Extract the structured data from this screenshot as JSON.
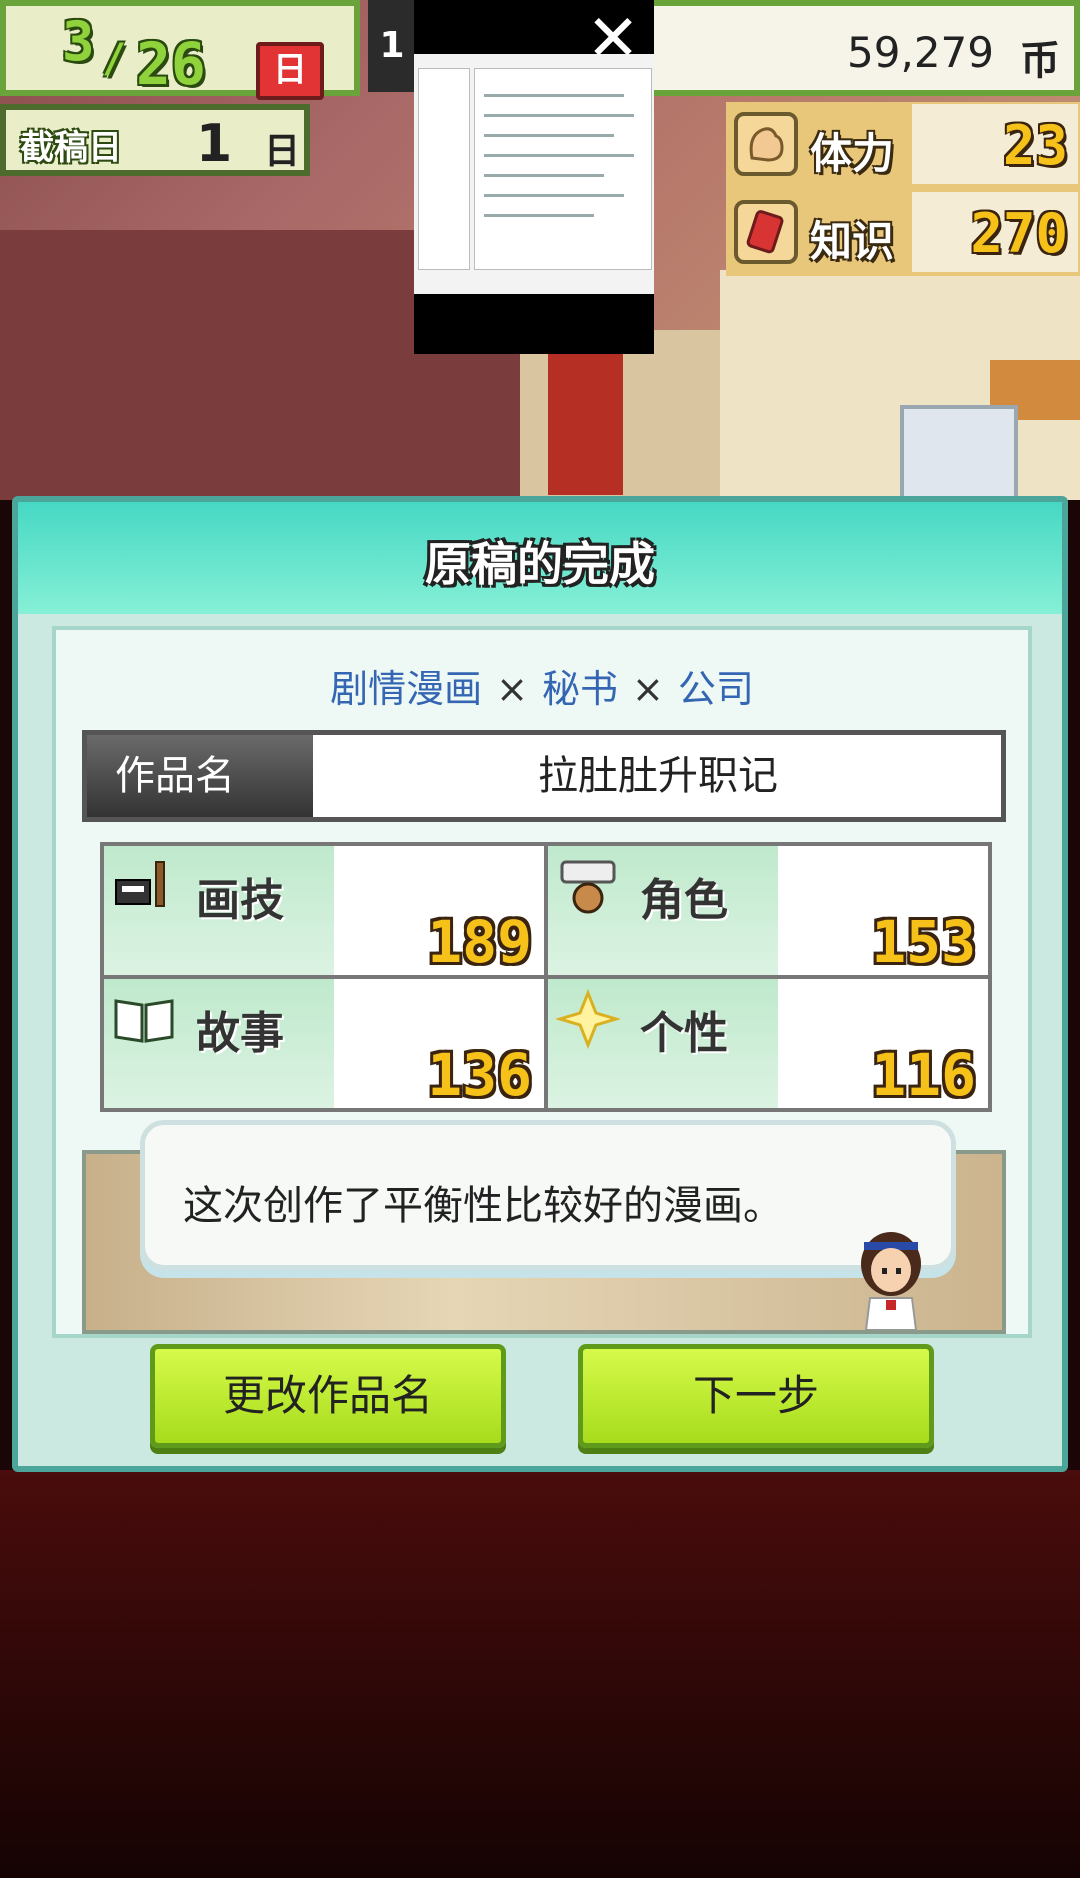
{
  "hud": {
    "date": {
      "month": "3",
      "day": "26",
      "weekday": "日"
    },
    "left_digit": "1",
    "money": {
      "value": "59,279",
      "unit": "币"
    },
    "deadline": {
      "label": "截稿日",
      "value": "1",
      "unit": "日"
    },
    "stats": [
      {
        "label": "体力",
        "value": "23",
        "icon": "muscle-icon"
      },
      {
        "label": "知识",
        "value": "270",
        "icon": "book-icon"
      }
    ]
  },
  "dialog": {
    "title": "原稿的完成",
    "genre": {
      "a": "剧情漫画",
      "b": "秘书",
      "c": "公司",
      "sep": "×"
    },
    "work_name": {
      "label": "作品名",
      "value": "拉肚肚升职记"
    },
    "attributes": [
      {
        "label": "画技",
        "value": "189",
        "icon": "pen-tablet-icon"
      },
      {
        "label": "角色",
        "value": "153",
        "icon": "character-icon"
      },
      {
        "label": "故事",
        "value": "136",
        "icon": "open-book-icon"
      },
      {
        "label": "个性",
        "value": "116",
        "icon": "sparkle-icon"
      }
    ],
    "message": "这次创作了平衡性比较好的漫画。",
    "buttons": {
      "rename": "更改作品名",
      "next": "下一步"
    }
  },
  "overlay": {
    "close_icon": "close-icon"
  },
  "colors": {
    "accent_green": "#a7dc1c",
    "title_teal": "#46d8c4",
    "value_gold": "#f6c21a",
    "genre_blue": "#3566b4"
  }
}
